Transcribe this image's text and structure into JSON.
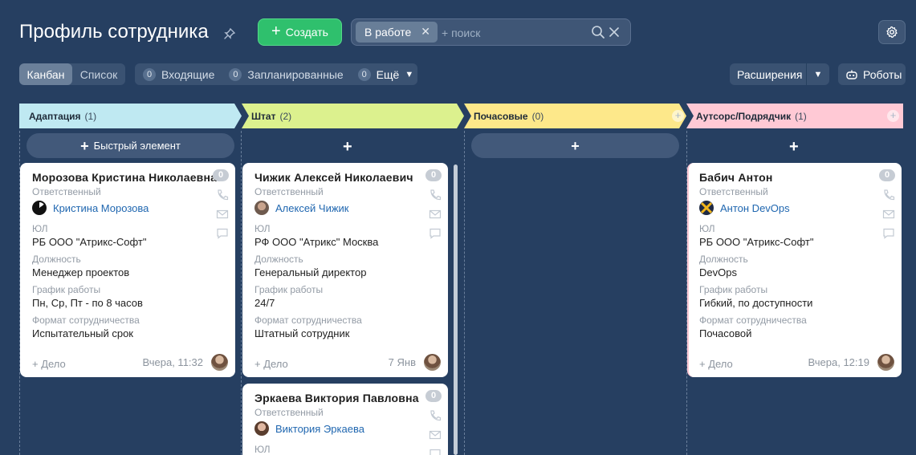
{
  "header": {
    "title": "Профиль сотрудника",
    "create_label": "Создать",
    "filter_chip": "В работе",
    "search_placeholder": "+ поиск"
  },
  "toolbar": {
    "view_tabs": [
      "Канбан",
      "Список"
    ],
    "counters": [
      {
        "count": "0",
        "label": "Входящие"
      },
      {
        "count": "0",
        "label": "Запланированные"
      },
      {
        "count": "0",
        "label": "Ещё"
      }
    ],
    "extensions_label": "Расширения",
    "robots_label": "Роботы"
  },
  "columns": [
    {
      "title": "Адаптация",
      "count": "(1)",
      "color": "#bfe9f2",
      "quick_add": "Быстрый элемент"
    },
    {
      "title": "Штат",
      "count": "(2)",
      "color": "#dcf18e"
    },
    {
      "title": "Почасовые",
      "count": "(0)",
      "color": "#fde88a"
    },
    {
      "title": "Аутсорс/Подрядчик",
      "count": "(1)",
      "color": "#ffc9d5"
    }
  ],
  "labels": {
    "responsible": "Ответственный",
    "legal_entity": "ЮЛ",
    "position": "Должность",
    "schedule": "График работы",
    "format": "Формат сотрудничества",
    "deal": "+ Дело",
    "zero": "0"
  },
  "cards": [
    {
      "name": "Морозова Кристина Николаевна",
      "responsible": "Кристина Морозова",
      "legal_entity": "РБ ООО \"Атрикс-Софт\"",
      "position": "Менеджер проектов",
      "schedule": "Пн, Ср, Пт - по 8 часов",
      "format": "Испытательный срок",
      "date": "Вчера, 11:32"
    },
    {
      "name": "Чижик Алексей Николаевич",
      "responsible": "Алексей Чижик",
      "legal_entity": "РФ ООО \"Атрикс\" Москва",
      "position": "Генеральный директор",
      "schedule": "24/7",
      "format": "Штатный сотрудник",
      "date": "7 Янв"
    },
    {
      "name": "Эркаева Виктория Павловна",
      "responsible": "Виктория Эркаева"
    },
    {
      "name": "Бабич Антон",
      "responsible": "Антон DevOps",
      "legal_entity": "РБ ООО \"Атрикс-Софт\"",
      "position": "DevOps",
      "schedule": "Гибкий, по доступности",
      "format": "Почасовой",
      "date": "Вчера, 12:19"
    }
  ]
}
